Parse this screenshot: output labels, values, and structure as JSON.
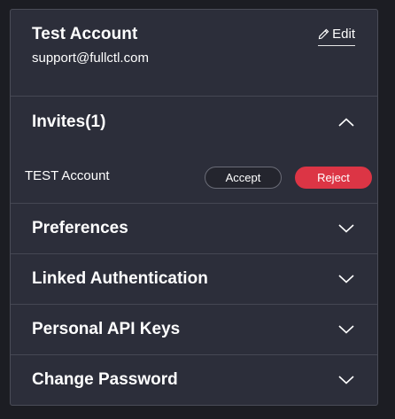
{
  "account": {
    "name": "Test Account",
    "email": "support@fullctl.com",
    "edit_label": "Edit"
  },
  "sections": [
    {
      "title": "Invites(1)",
      "expanded": true
    },
    {
      "title": "Preferences",
      "expanded": false
    },
    {
      "title": "Linked Authentication",
      "expanded": false
    },
    {
      "title": "Personal API Keys",
      "expanded": false
    },
    {
      "title": "Change Password",
      "expanded": false
    }
  ],
  "invites": [
    {
      "name": "TEST Account",
      "accept_label": "Accept",
      "reject_label": "Reject"
    }
  ],
  "colors": {
    "background": "#1c1d23",
    "panel": "#2c2e3a",
    "reject": "#dc3545"
  }
}
